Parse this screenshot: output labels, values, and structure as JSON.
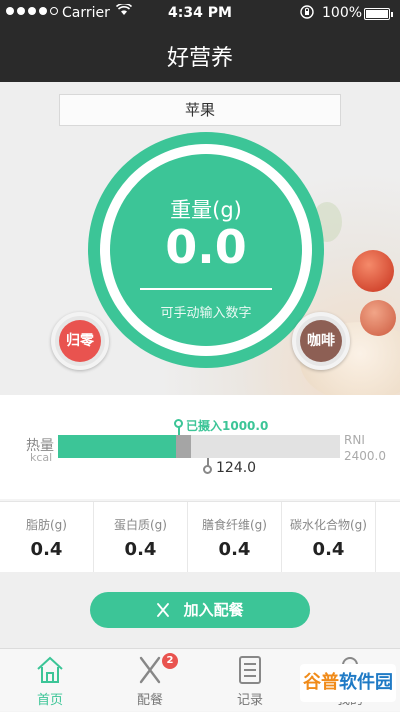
{
  "status_bar": {
    "carrier": "Carrier",
    "time": "4:34 PM",
    "battery_pct": "100%"
  },
  "nav": {
    "title": "好营养"
  },
  "food": {
    "name": "苹果",
    "weight_label": "重量(g)",
    "weight_value": "0.0",
    "weight_hint": "可手动输入数字"
  },
  "buttons": {
    "zero_label": "归零",
    "food_label": "咖啡",
    "add_meal_label": "加入配餐"
  },
  "energy": {
    "label": "热量",
    "unit": "kcal",
    "rni_label": "RNI",
    "rni_value": "2400.0",
    "ate_label": "已摄入1000.0",
    "add_value": "124.0",
    "ate_fraction": 0.417,
    "add_fraction": 0.052
  },
  "nutrients": [
    {
      "name": "脂肪(g)",
      "value": "0.4"
    },
    {
      "name": "蛋白质(g)",
      "value": "0.4"
    },
    {
      "name": "膳食纤维(g)",
      "value": "0.4"
    },
    {
      "name": "碳水化合物(g)",
      "value": "0.4"
    }
  ],
  "tabs": [
    {
      "label": "首页",
      "icon": "home-icon",
      "active": true
    },
    {
      "label": "配餐",
      "icon": "fork-knife-icon",
      "badge": "2"
    },
    {
      "label": "记录",
      "icon": "list-icon"
    },
    {
      "label": "我的",
      "icon": "person-icon"
    }
  ],
  "watermark": {
    "part1": "谷普",
    "part2": "软件园"
  },
  "colors": {
    "accent": "#3cc597",
    "nav_bg": "#2a2a2a",
    "zero_btn": "#e9534f",
    "food_btn": "#8d5f54",
    "badge": "#e9534f"
  }
}
